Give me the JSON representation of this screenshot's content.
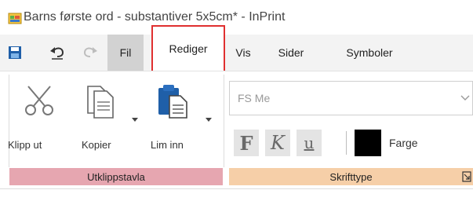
{
  "window": {
    "title": "Barns første ord - substantiver 5x5cm* - InPrint"
  },
  "tabs": [
    {
      "label": "Fil",
      "state": "hover"
    },
    {
      "label": "Rediger",
      "state": "active",
      "highlight_color": "#e03030"
    },
    {
      "label": "Vis"
    },
    {
      "label": "Sider"
    },
    {
      "label": "Symboler"
    }
  ],
  "quick_access": {
    "icons": [
      "save-icon",
      "undo-icon",
      "redo-icon"
    ]
  },
  "clipboard": {
    "cut_label": "Klipp ut",
    "copy_label": "Kopier",
    "paste_label": "Lim inn",
    "group_label": "Utklippstavla",
    "group_color": "#e6a6b0"
  },
  "font": {
    "font_name": "FS Me",
    "bold_label": "F",
    "italic_label": "K",
    "underline_label": "u",
    "color_label": "Farge",
    "color_value": "#000000",
    "group_label": "Skrifttype",
    "group_color": "#f6cfa8"
  }
}
